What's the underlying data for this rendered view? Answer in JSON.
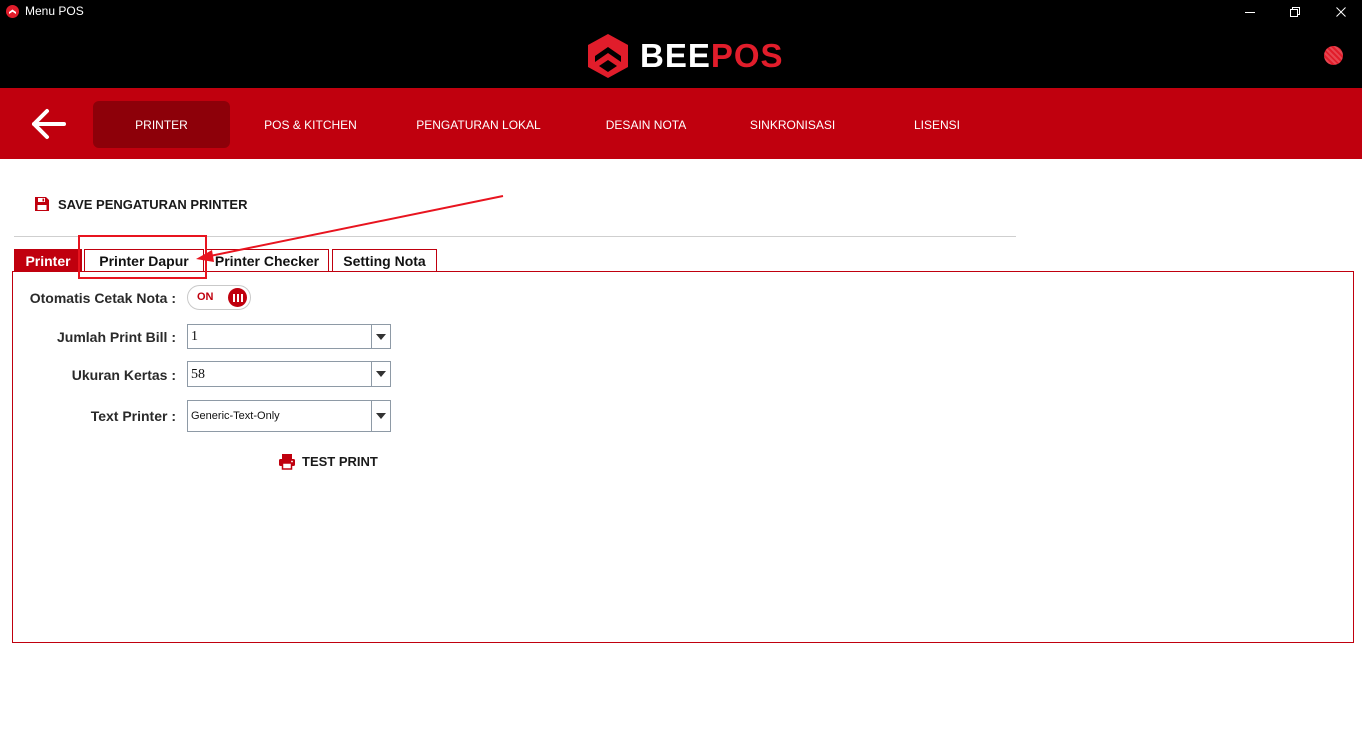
{
  "window": {
    "title": "Menu POS",
    "controls": [
      "minimize",
      "restore",
      "close"
    ]
  },
  "header": {
    "brand_part1": "BEE",
    "brand_part2": "POS",
    "colors": {
      "brand_red": "#e11d2b",
      "nav_red": "#c0000e",
      "nav_active": "#8d0009"
    }
  },
  "nav": {
    "back_icon": "arrow-left-icon",
    "items": [
      {
        "label": "PRINTER",
        "active": true
      },
      {
        "label": "POS & KITCHEN"
      },
      {
        "label": "PENGATURAN LOKAL"
      },
      {
        "label": "DESAIN NOTA"
      },
      {
        "label": "SINKRONISASI"
      },
      {
        "label": "LISENSI"
      }
    ]
  },
  "toolbar": {
    "save_label": "SAVE PENGATURAN PRINTER",
    "save_icon": "floppy-disk-icon"
  },
  "tabs": [
    {
      "label": "Printer",
      "active": true
    },
    {
      "label": "Printer Dapur"
    },
    {
      "label": "Printer Checker"
    },
    {
      "label": "Setting Nota"
    }
  ],
  "form": {
    "auto_print": {
      "label": "Otomatis Cetak Nota :",
      "state": "ON"
    },
    "bill_count": {
      "label": "Jumlah Print Bill :",
      "value": "1"
    },
    "paper_size": {
      "label": "Ukuran Kertas :",
      "value": "58"
    },
    "text_printer": {
      "label": "Text Printer :",
      "value": "Generic-Text-Only"
    },
    "test_print_label": "TEST PRINT",
    "test_print_icon": "printer-icon"
  }
}
